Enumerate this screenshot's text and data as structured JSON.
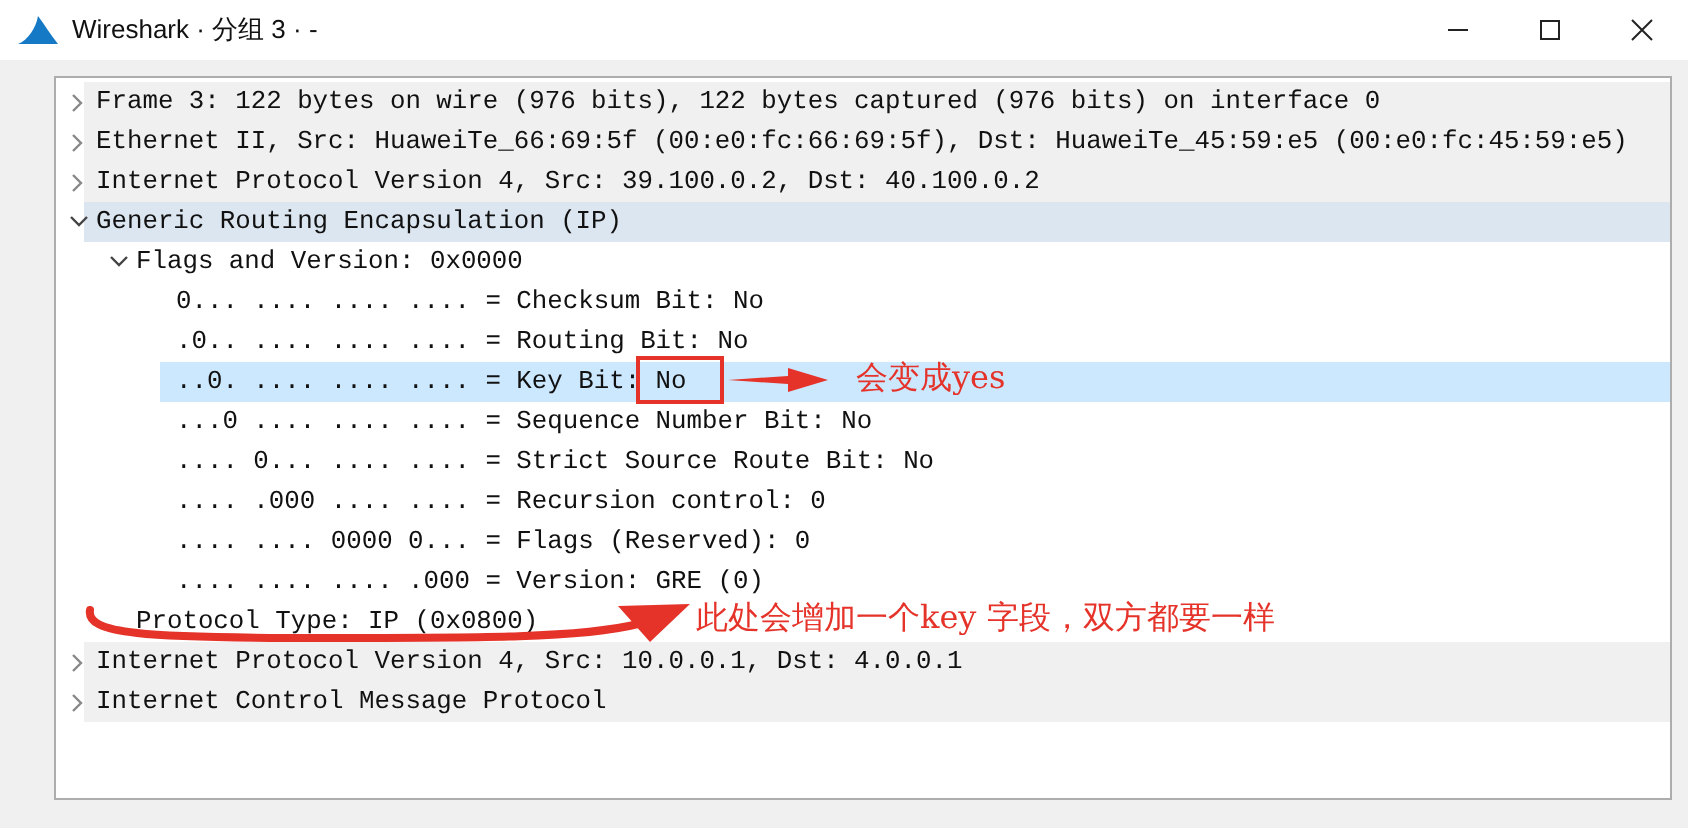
{
  "window": {
    "title": "Wireshark · 分组 3 · -"
  },
  "tree": [
    {
      "text": "Frame 3: 122 bytes on wire (976 bits), 122 bytes captured (976 bits) on interface 0",
      "expanded": false,
      "selected": false
    },
    {
      "text": "Ethernet II, Src: HuaweiTe_66:69:5f (00:e0:fc:66:69:5f), Dst: HuaweiTe_45:59:e5 (00:e0:fc:45:59:e5)",
      "expanded": false,
      "selected": false
    },
    {
      "text": "Internet Protocol Version 4, Src: 39.100.0.2, Dst: 40.100.0.2",
      "expanded": false,
      "selected": false
    },
    {
      "text": "Generic Routing Encapsulation (IP)",
      "expanded": true,
      "selected": false,
      "children": [
        {
          "text": "Flags and Version: 0x0000",
          "expanded": true,
          "selected": false,
          "children": [
            {
              "text": "0... .... .... .... = Checksum Bit: No",
              "selected": false
            },
            {
              "text": ".0.. .... .... .... = Routing Bit: No",
              "selected": false
            },
            {
              "text": "..0. .... .... .... = Key Bit: No",
              "selected": true
            },
            {
              "text": "...0 .... .... .... = Sequence Number Bit: No",
              "selected": false
            },
            {
              "text": ".... 0... .... .... = Strict Source Route Bit: No",
              "selected": false
            },
            {
              "text": ".... .000 .... .... = Recursion control: 0",
              "selected": false
            },
            {
              "text": ".... .... 0000 0... = Flags (Reserved): 0",
              "selected": false
            },
            {
              "text": ".... .... .... .000 = Version: GRE (0)",
              "selected": false
            }
          ]
        },
        {
          "text": "Protocol Type: IP (0x0800)",
          "selected": false
        }
      ]
    },
    {
      "text": "Internet Protocol Version 4, Src: 10.0.0.1, Dst: 4.0.0.1",
      "expanded": false,
      "selected": false
    },
    {
      "text": "Internet Control Message Protocol",
      "expanded": false,
      "selected": false
    }
  ],
  "annotations": [
    {
      "text": "会变成yes"
    },
    {
      "text": "此处会增加一个key 字段，双方都要一样"
    }
  ]
}
